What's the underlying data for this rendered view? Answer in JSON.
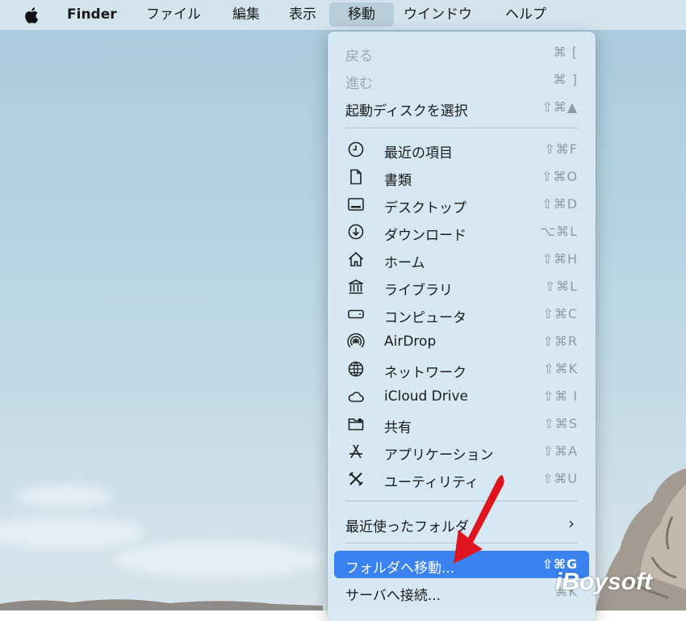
{
  "menubar": {
    "app_name": "Finder",
    "items": [
      "ファイル",
      "編集",
      "表示",
      "移動",
      "ウインドウ",
      "ヘルプ"
    ],
    "active_item": "移動"
  },
  "go_menu": {
    "back": {
      "label": "戻る",
      "shortcut": "⌘ ["
    },
    "forward": {
      "label": "進む",
      "shortcut": "⌘ ]"
    },
    "startup_disk": {
      "label": "起動ディスクを選択",
      "shortcut": "⇧⌘▲"
    },
    "places": [
      {
        "label": "最近の項目",
        "shortcut": "⇧⌘F",
        "icon": "clock-icon"
      },
      {
        "label": "書類",
        "shortcut": "⇧⌘O",
        "icon": "document-icon"
      },
      {
        "label": "デスクトップ",
        "shortcut": "⇧⌘D",
        "icon": "desktop-icon"
      },
      {
        "label": "ダウンロード",
        "shortcut": "⌥⌘L",
        "icon": "download-icon"
      },
      {
        "label": "ホーム",
        "shortcut": "⇧⌘H",
        "icon": "home-icon"
      },
      {
        "label": "ライブラリ",
        "shortcut": "⇧⌘L",
        "icon": "library-icon"
      },
      {
        "label": "コンピュータ",
        "shortcut": "⇧⌘C",
        "icon": "computer-icon"
      },
      {
        "label": "AirDrop",
        "shortcut": "⇧⌘R",
        "icon": "airdrop-icon"
      },
      {
        "label": "ネットワーク",
        "shortcut": "⇧⌘K",
        "icon": "network-icon"
      },
      {
        "label": "iCloud Drive",
        "shortcut": "⇧⌘ I",
        "icon": "cloud-icon"
      },
      {
        "label": "共有",
        "shortcut": "⇧⌘S",
        "icon": "shared-folder-icon"
      },
      {
        "label": "アプリケーション",
        "shortcut": "⇧⌘A",
        "icon": "applications-icon"
      },
      {
        "label": "ユーティリティ",
        "shortcut": "⇧⌘U",
        "icon": "utilities-icon"
      }
    ],
    "recent_folders": {
      "label": "最近使ったフォルダ",
      "chevron": "›"
    },
    "go_to_folder": {
      "label": "フォルダへ移動...",
      "shortcut": "⇧⌘G"
    },
    "connect_server": {
      "label": "サーバへ接続...",
      "shortcut": "⌘K"
    }
  },
  "watermark": "iBoysoft",
  "colors": {
    "selection": "#3a82f0",
    "arrow": "#e0141e"
  }
}
